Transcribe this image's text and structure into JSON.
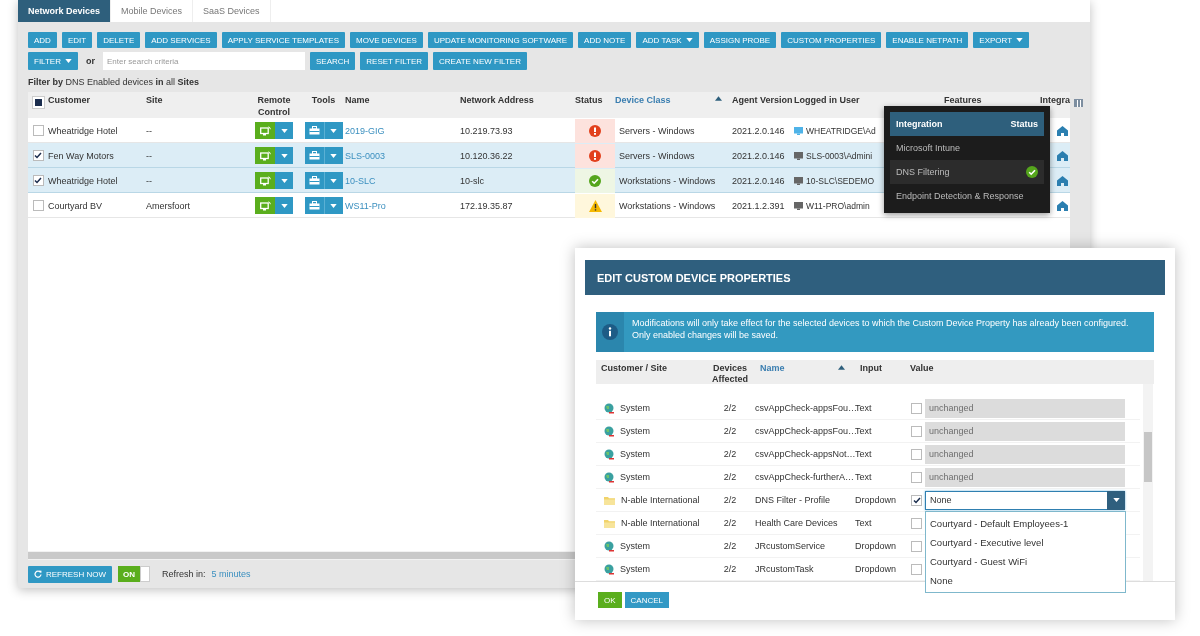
{
  "tabs": [
    {
      "label": "Network Devices",
      "selected": true
    },
    {
      "label": "Mobile Devices",
      "selected": false
    },
    {
      "label": "SaaS Devices",
      "selected": false
    }
  ],
  "toolbar": [
    {
      "label": "ADD",
      "dropdown": false
    },
    {
      "label": "EDIT",
      "dropdown": false
    },
    {
      "label": "DELETE",
      "dropdown": false
    },
    {
      "label": "ADD SERVICES",
      "dropdown": false
    },
    {
      "label": "APPLY SERVICE TEMPLATES",
      "dropdown": false
    },
    {
      "label": "MOVE DEVICES",
      "dropdown": false
    },
    {
      "label": "UPDATE MONITORING SOFTWARE",
      "dropdown": false
    },
    {
      "label": "ADD NOTE",
      "dropdown": false
    },
    {
      "label": "ADD TASK",
      "dropdown": true
    },
    {
      "label": "ASSIGN PROBE",
      "dropdown": false
    },
    {
      "label": "CUSTOM PROPERTIES",
      "dropdown": false
    },
    {
      "label": "ENABLE NETPATH",
      "dropdown": false
    },
    {
      "label": "EXPORT",
      "dropdown": true
    }
  ],
  "filter_bar": {
    "filter_button": "FILTER",
    "or": "or",
    "search": {
      "placeholder": "Enter search criteria"
    },
    "buttons": [
      "SEARCH",
      "RESET FILTER",
      "CREATE NEW FILTER"
    ]
  },
  "filter_summary": "**Filter by** DNS Enabled devices **in** all **Sites**",
  "table": {
    "select_all": {
      "indeterminate": true
    },
    "columns": [
      {
        "label": "Customer",
        "sorted": false
      },
      {
        "label": "Site",
        "sorted": false
      },
      {
        "label": "Remote Control",
        "sorted": false
      },
      {
        "label": "Tools",
        "sorted": false
      },
      {
        "label": "Name",
        "sorted": false
      },
      {
        "label": "Network Address",
        "sorted": false
      },
      {
        "label": "Status",
        "sorted": false
      },
      {
        "label": "Device Class",
        "sorted": true
      },
      {
        "label": "Agent Version",
        "sorted": false
      },
      {
        "label": "Logged in User",
        "sorted": false
      },
      {
        "label": "Features",
        "sorted": false
      },
      {
        "label": "Integra",
        "sorted": false
      }
    ],
    "rows": [
      {
        "customer": "Wheatridge Hotel",
        "site": "--",
        "name": "2019-GIG",
        "address": "10.219.73.93",
        "kind": "error",
        "device_class": "Servers - Windows",
        "agent": "2021.2.0.146",
        "user": "WHEATRIDGE\\Ad",
        "online": true,
        "selected": false
      },
      {
        "customer": "Fen Way Motors",
        "site": "--",
        "name": "SLS-0003",
        "address": "10.120.36.22",
        "kind": "error",
        "device_class": "Servers - Windows",
        "agent": "2021.2.0.146",
        "user": "SLS-0003\\Admini",
        "online": false,
        "selected": true
      },
      {
        "customer": "Wheatridge Hotel",
        "site": "--",
        "name": "10-SLC",
        "address": "10-slc",
        "kind": "ok",
        "device_class": "Workstations - Windows",
        "agent": "2021.2.0.146",
        "user": "10-SLC\\SEDEMO",
        "online": false,
        "selected": true
      },
      {
        "customer": "Courtyard BV",
        "site": "Amersfoort",
        "name": "WS11-Pro",
        "address": "172.19.35.87",
        "kind": "warning",
        "device_class": "Workstations - Windows",
        "agent": "2021.1.2.391",
        "user": "W11-PRO\\admin",
        "online": false,
        "selected": false
      }
    ]
  },
  "integration_popup": {
    "columns": [
      "Integration",
      "Status"
    ],
    "items": [
      {
        "label": "Microsoft Intune",
        "selected": false,
        "enabled": false
      },
      {
        "label": "DNS Filtering",
        "selected": true,
        "enabled": true
      },
      {
        "label": "Endpoint Detection & Response",
        "selected": false,
        "enabled": false
      }
    ]
  },
  "footer": {
    "refresh_button": "REFRESH NOW",
    "toggle": {
      "label": "ON",
      "on": true
    },
    "refresh_label": "Refresh in:",
    "refresh_interval": "5 minutes"
  },
  "modal": {
    "title": "EDIT CUSTOM DEVICE PROPERTIES",
    "info": [
      "Modifications will only take effect for the selected devices to which the Custom Device Property has already been configured.",
      "Only enabled changes will be saved."
    ],
    "columns": [
      {
        "label": "Customer / Site",
        "sorted": false
      },
      {
        "label": "Devices Affected",
        "sorted": false
      },
      {
        "label": "Name",
        "sorted": true
      },
      {
        "label": "Input",
        "sorted": false
      },
      {
        "label": "Value",
        "sorted": false
      }
    ],
    "rows": [
      {
        "kind": "system",
        "customer": "System",
        "devices": "2/2",
        "name": "csvAppCheck-appsFou…",
        "input": "Text",
        "checked": false,
        "value": "unchanged"
      },
      {
        "kind": "system",
        "customer": "System",
        "devices": "2/2",
        "name": "csvAppCheck-appsFou…",
        "input": "Text",
        "checked": false,
        "value": "unchanged"
      },
      {
        "kind": "system",
        "customer": "System",
        "devices": "2/2",
        "name": "csvAppCheck-appsNot…",
        "input": "Text",
        "checked": false,
        "value": "unchanged"
      },
      {
        "kind": "system",
        "customer": "System",
        "devices": "2/2",
        "name": "csvAppCheck-furtherA…",
        "input": "Text",
        "checked": false,
        "value": "unchanged"
      },
      {
        "kind": "customer",
        "customer": "N-able International",
        "devices": "2/2",
        "name": "DNS Filter - Profile",
        "input": "Dropdown",
        "checked": true,
        "dropdown": {
          "value": "None",
          "expanded": true,
          "options": [
            "Courtyard - Default Employees-1",
            "Courtyard - Executive level",
            "Courtyard - Guest WiFi",
            "None"
          ]
        }
      },
      {
        "kind": "customer",
        "customer": "N-able International",
        "devices": "2/2",
        "name": "Health Care Devices",
        "input": "Text",
        "checked": false
      },
      {
        "kind": "system",
        "customer": "System",
        "devices": "2/2",
        "name": "JRcustomService",
        "input": "Dropdown",
        "checked": false
      },
      {
        "kind": "system",
        "customer": "System",
        "devices": "2/2",
        "name": "JRcustomTask",
        "input": "Dropdown",
        "checked": false
      }
    ],
    "buttons": [
      {
        "label": "OK",
        "kind": "primary"
      },
      {
        "label": "CANCEL",
        "kind": "secondary"
      }
    ]
  }
}
